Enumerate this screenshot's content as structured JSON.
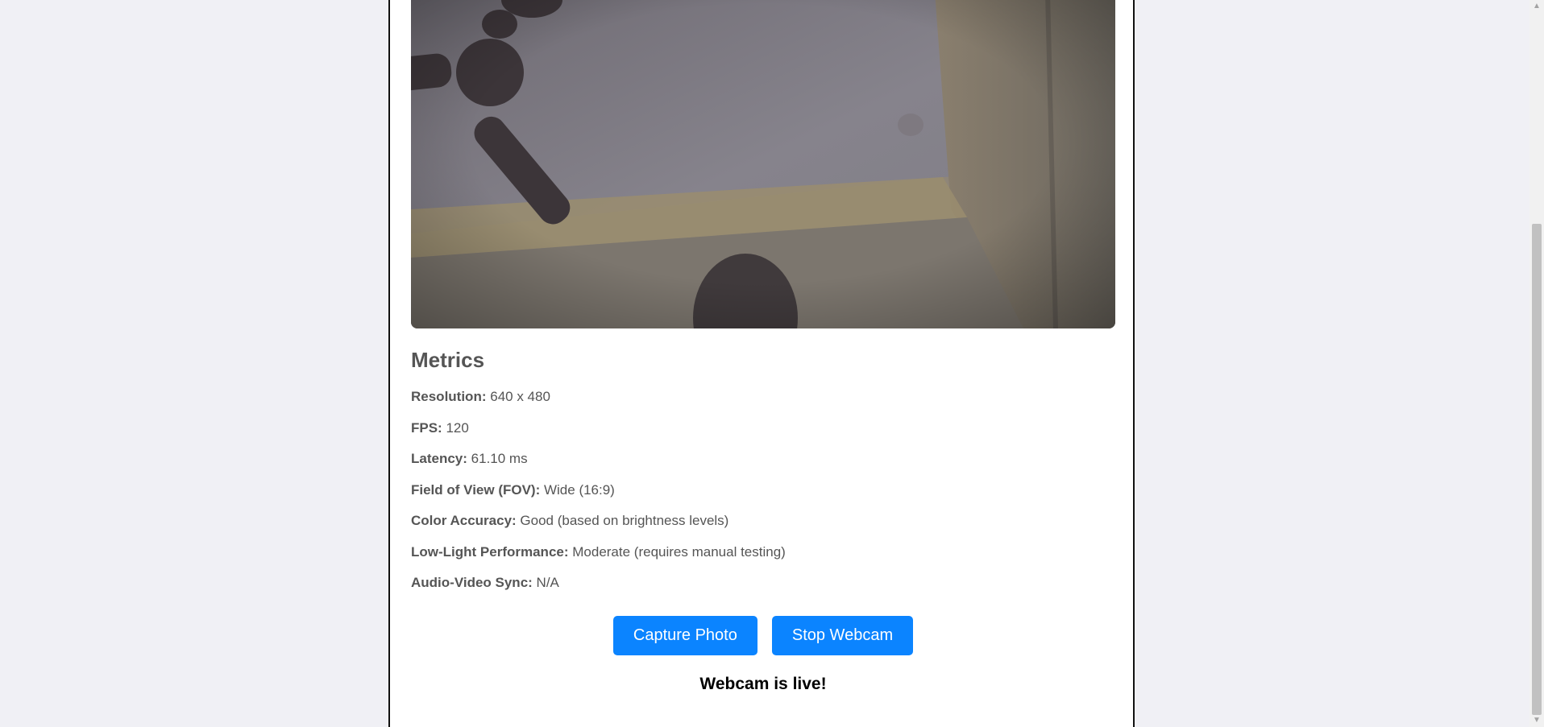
{
  "metrics": {
    "heading": "Metrics",
    "items": [
      {
        "label": "Resolution:",
        "value": "640 x 480"
      },
      {
        "label": "FPS:",
        "value": "120"
      },
      {
        "label": "Latency:",
        "value": "61.10 ms"
      },
      {
        "label": "Field of View (FOV):",
        "value": "Wide (16:9)"
      },
      {
        "label": "Color Accuracy:",
        "value": "Good (based on brightness levels)"
      },
      {
        "label": "Low-Light Performance:",
        "value": "Moderate (requires manual testing)"
      },
      {
        "label": "Audio-Video Sync:",
        "value": "N/A"
      }
    ]
  },
  "actions": {
    "capture_label": "Capture Photo",
    "stop_label": "Stop Webcam"
  },
  "status": {
    "text": "Webcam is live!"
  },
  "colors": {
    "accent": "#0b84ff",
    "page_bg": "#f0f0f5"
  },
  "icons": {
    "scroll_up": "arrow-up-icon",
    "scroll_down": "arrow-down-icon"
  }
}
